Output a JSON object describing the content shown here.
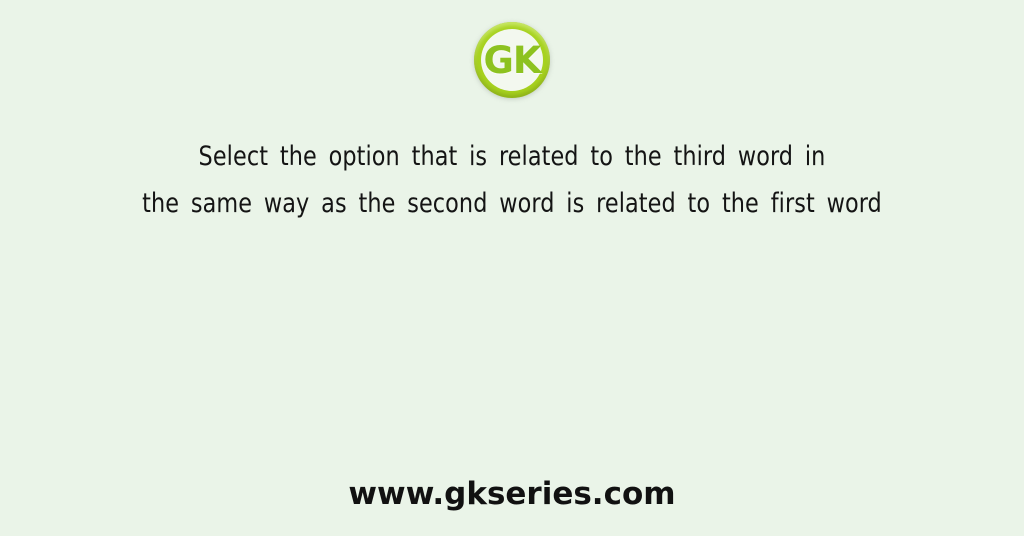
{
  "page": {
    "background_color": "#eaf4e8",
    "text_color": "#141414"
  },
  "logo": {
    "name": "gk-logo",
    "text": "GK",
    "ring_color": "#a7d21f",
    "letter_color": "#8dc220",
    "inner_color": "#f3f8ef"
  },
  "question": {
    "line1": "Select the option that is related to the third word in",
    "line2": "the same way as the second word is related to the first word",
    "full_text": "Select the option that is related to the third word in the same way as the second word is related to the first word"
  },
  "footer": {
    "website": "www.gkseries.com"
  }
}
